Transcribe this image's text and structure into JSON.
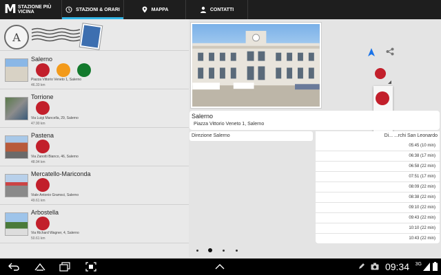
{
  "app": {
    "logo_letter": "M",
    "logo_line1": "STAZIONE PIÙ",
    "logo_line2": "VICINA"
  },
  "tabs": [
    {
      "label": "STAZIONI & ORARI",
      "icon": "clock-icon",
      "active": true
    },
    {
      "label": "MAPPA",
      "icon": "map-pin-icon",
      "active": false
    },
    {
      "label": "CONTATTI",
      "icon": "person-icon",
      "active": false
    }
  ],
  "stations": [
    {
      "name": "Salerno",
      "address": "Piazza Vittorio Veneto 1, Salerno",
      "distance": "46.33 km",
      "lights": [
        "red",
        "orange",
        "green"
      ]
    },
    {
      "name": "Torrione",
      "address": "Via Luigi Mancella, 29, Salerno",
      "distance": "47.90 km",
      "lights": [
        "red"
      ]
    },
    {
      "name": "Pastena",
      "address": "Via Zanotti Bianco, 46, Salerno",
      "distance": "48.94 km",
      "lights": [
        "red"
      ]
    },
    {
      "name": "Mercatello-Mariconda",
      "address": "Viale Antonio Gramsci, Salerno",
      "distance": "49.61 km",
      "lights": [
        "red"
      ]
    },
    {
      "name": "Arbostella",
      "address": "Via Richard Wagner, 4, Salerno",
      "distance": "50.61 km",
      "lights": [
        "red"
      ]
    }
  ],
  "detail": {
    "title": "Salerno",
    "address": "Piazza Vittorio Veneto 1, Salerno",
    "direction_left": "Direzione Salerno",
    "direction_right": "Di... ...rchi San Leonardo",
    "times": [
      "05:45 (10 min)",
      "06:38 (17 min)",
      "06:58 (22 min)",
      "07:51 (17 min)",
      "08:09 (22 min)",
      "08:38 (22 min)",
      "09:10 (22 min)",
      "09:43 (22 min)",
      "10:10 (22 min)",
      "10:43 (22 min)"
    ]
  },
  "popup_options": [
    "red",
    "orange",
    "green"
  ],
  "pager": {
    "count": 4,
    "active_index": 1
  },
  "system": {
    "clock": "09:34",
    "network": "3G"
  },
  "colors": {
    "accent": "#33b5e5",
    "red": "#c21f2b",
    "orange": "#f39a1a",
    "green": "#137a2d",
    "navigation": "#1a73e8"
  }
}
